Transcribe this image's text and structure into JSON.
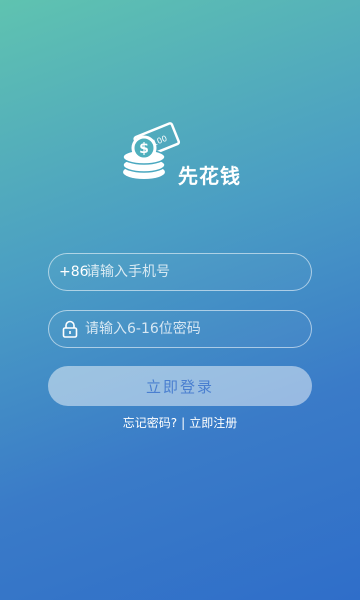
{
  "brand": {
    "name": "先花钱",
    "banknote_text": "¥100",
    "coin_symbol": "$"
  },
  "phone": {
    "prefix": "+86",
    "placeholder": "请输入手机号"
  },
  "password": {
    "placeholder": "请输入6-16位密码",
    "icon": "lock-icon"
  },
  "login_button": {
    "label": "立即登录"
  },
  "links": {
    "forgot": "忘记密码?",
    "separator": "|",
    "register": "立即注册"
  },
  "colors": {
    "background_top": "#5fc3b0",
    "background_bottom": "#2f6ec9",
    "button_text": "#4a7fd0"
  }
}
